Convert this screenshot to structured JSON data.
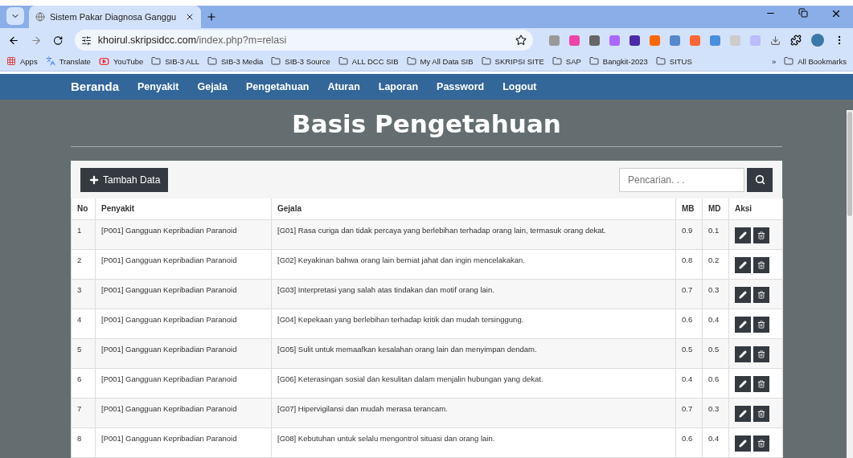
{
  "browser": {
    "tab_title": "Sistem Pakar Diagnosa Ganggu",
    "url_host": "khoirul.skripsidcc.com",
    "url_path": "/index.php?m=relasi",
    "bookmarks": [
      {
        "kind": "apps",
        "label": "Apps"
      },
      {
        "kind": "translate",
        "label": "Translate"
      },
      {
        "kind": "youtube",
        "label": "YouTube"
      },
      {
        "kind": "folder",
        "label": "SIB-3 ALL"
      },
      {
        "kind": "folder",
        "label": "SIB-3 Media"
      },
      {
        "kind": "folder",
        "label": "SIB-3 Source"
      },
      {
        "kind": "folder",
        "label": "ALL DCC SIB"
      },
      {
        "kind": "folder",
        "label": "My All Data SIB"
      },
      {
        "kind": "folder",
        "label": "SKRIPSI SITE"
      },
      {
        "kind": "folder",
        "label": "SAP"
      },
      {
        "kind": "folder",
        "label": "Bangkit-2023"
      },
      {
        "kind": "folder",
        "label": "SITUS"
      }
    ],
    "more": "»",
    "all_bookmarks": "All Bookmarks"
  },
  "navbar": [
    {
      "kind": "brand",
      "label": "Beranda"
    },
    {
      "kind": "link",
      "label": "Penyakit"
    },
    {
      "kind": "link",
      "label": "Gejala"
    },
    {
      "kind": "link",
      "label": "Pengetahuan"
    },
    {
      "kind": "link",
      "label": "Aturan"
    },
    {
      "kind": "link",
      "label": "Laporan"
    },
    {
      "kind": "link",
      "label": "Password"
    },
    {
      "kind": "link",
      "label": "Logout"
    }
  ],
  "page_title": "Basis Pengetahuan",
  "add_button": "Tambah Data",
  "search": {
    "placeholder": "Pencarian. . ."
  },
  "table": {
    "columns": [
      "No",
      "Penyakit",
      "Gejala",
      "MB",
      "MD",
      "Aksi"
    ],
    "rows": [
      {
        "no": "1",
        "penyakit": "[P001] Gangguan Kepribadian Paranoid",
        "gejala": "[G01] Rasa curiga dan tidak percaya yang berlebihan terhadap orang lain, termasuk orang dekat.",
        "mb": "0.9",
        "md": "0.1"
      },
      {
        "no": "2",
        "penyakit": "[P001] Gangguan Kepribadian Paranoid",
        "gejala": "[G02] Keyakinan bahwa orang lain berniat jahat dan ingin mencelakakan.",
        "mb": "0.8",
        "md": "0.2"
      },
      {
        "no": "3",
        "penyakit": "[P001] Gangguan Kepribadian Paranoid",
        "gejala": "[G03] Interpretasi yang salah atas tindakan dan motif orang lain.",
        "mb": "0.7",
        "md": "0.3"
      },
      {
        "no": "4",
        "penyakit": "[P001] Gangguan Kepribadian Paranoid",
        "gejala": "[G04] Kepekaan yang berlebihan terhadap kritik dan mudah tersinggung.",
        "mb": "0.6",
        "md": "0.4"
      },
      {
        "no": "5",
        "penyakit": "[P001] Gangguan Kepribadian Paranoid",
        "gejala": "[G05] Sulit untuk memaafkan kesalahan orang lain dan menyimpan dendam.",
        "mb": "0.5",
        "md": "0.5"
      },
      {
        "no": "6",
        "penyakit": "[P001] Gangguan Kepribadian Paranoid",
        "gejala": "[G06] Keterasingan sosial dan kesulitan dalam menjalin hubungan yang dekat.",
        "mb": "0.4",
        "md": "0.6"
      },
      {
        "no": "7",
        "penyakit": "[P001] Gangguan Kepribadian Paranoid",
        "gejala": "[G07] Hipervigilansi dan mudah merasa terancam.",
        "mb": "0.7",
        "md": "0.3"
      },
      {
        "no": "8",
        "penyakit": "[P001] Gangguan Kepribadian Paranoid",
        "gejala": "[G08] Kebutuhan untuk selalu mengontrol situasi dan orang lain.",
        "mb": "0.6",
        "md": "0.4"
      }
    ]
  }
}
